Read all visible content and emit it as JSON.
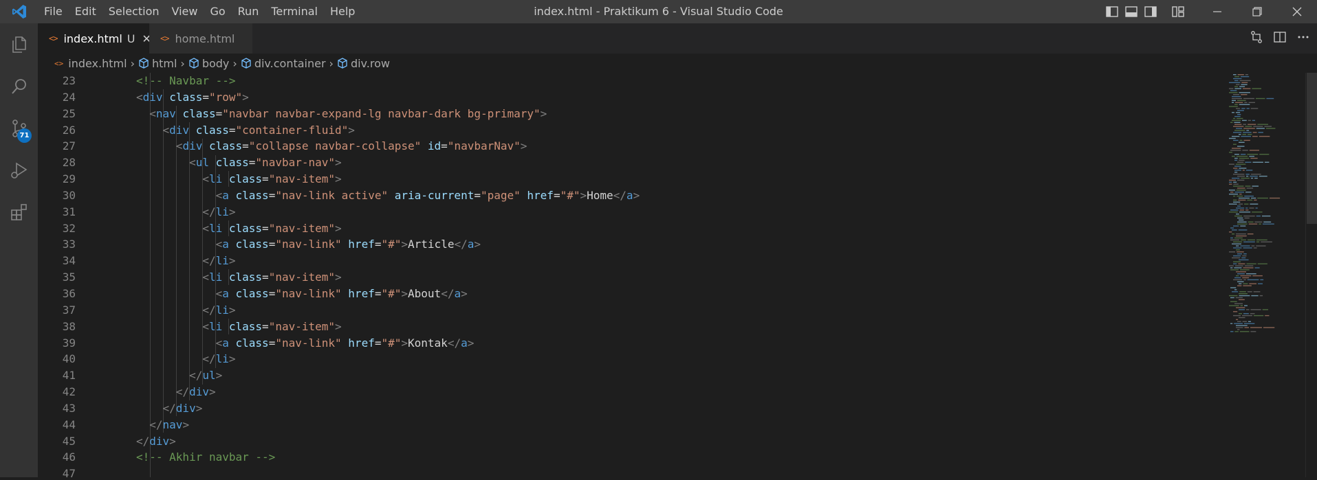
{
  "window": {
    "title": "index.html - Praktikum 6 - Visual Studio Code"
  },
  "menu": [
    "File",
    "Edit",
    "Selection",
    "View",
    "Go",
    "Run",
    "Terminal",
    "Help"
  ],
  "activity_bar": {
    "items": [
      "explorer-icon",
      "search-icon",
      "source-control-icon",
      "run-debug-icon",
      "extensions-icon"
    ],
    "source_control_badge": "71"
  },
  "tabs": [
    {
      "label": "index.html",
      "modified": "U",
      "active": true
    },
    {
      "label": "home.html",
      "active": false
    }
  ],
  "breadcrumb": [
    "index.html",
    "html",
    "body",
    "div.container",
    "div.row"
  ],
  "editor": {
    "line_numbers": [
      "23",
      "24",
      "25",
      "26",
      "27",
      "28",
      "29",
      "30",
      "31",
      "32",
      "33",
      "34",
      "35",
      "36",
      "37",
      "38",
      "39",
      "40",
      "41",
      "42",
      "43",
      "44",
      "45",
      "46",
      "47"
    ]
  },
  "colors": {
    "accent": "#0e70c0",
    "titlebar": "#3c3c3c",
    "activitybar": "#333333",
    "editor_bg": "#1e1e1e",
    "tag": "#569cd6",
    "attribute": "#9cdcfe",
    "string": "#ce9178",
    "comment": "#6a9955"
  }
}
